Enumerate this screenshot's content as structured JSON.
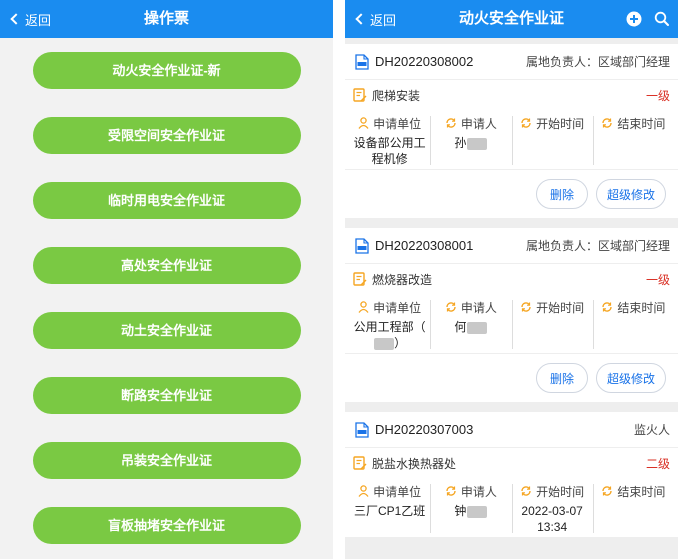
{
  "left": {
    "back_label": "返回",
    "title": "操作票",
    "menu": [
      "动火安全作业证-新",
      "受限空间安全作业证",
      "临时用电安全作业证",
      "高处安全作业证",
      "动土安全作业证",
      "断路安全作业证",
      "吊装安全作业证",
      "盲板抽堵安全作业证"
    ]
  },
  "right": {
    "back_label": "返回",
    "title": "动火安全作业证",
    "icons": [
      "add-circle-icon",
      "search-icon"
    ],
    "field_labels": {
      "unit": "申请单位",
      "applicant": "申请人",
      "start": "开始时间",
      "end": "结束时间"
    },
    "delete_label": "删除",
    "super_edit_label": "超级修改",
    "cards": [
      {
        "code": "DH20220308002",
        "owner": "属地负责人：区域部门经理",
        "task": "爬梯安装",
        "level": "一级",
        "unit": "设备部公用工程机修",
        "applicant": "孙",
        "start": "",
        "end": ""
      },
      {
        "code": "DH20220308001",
        "owner": "属地负责人：区域部门经理",
        "task": "燃烧器改造",
        "level": "一级",
        "unit": "公用工程部（",
        "unit_tail": "）",
        "applicant": "何",
        "start": "",
        "end": ""
      },
      {
        "code": "DH20220307003",
        "owner": "监火人",
        "task": "脱盐水换热器处",
        "level": "二级",
        "unit": "三厂CP1乙班",
        "applicant": "钟",
        "start": "2022-03-07 13:34",
        "end": ""
      }
    ]
  },
  "colors": {
    "nav": "#1a8cf0",
    "menu_button": "#7ac943",
    "level": "#d93025",
    "link": "#1a73e8",
    "icon_orange": "#f5a623"
  }
}
